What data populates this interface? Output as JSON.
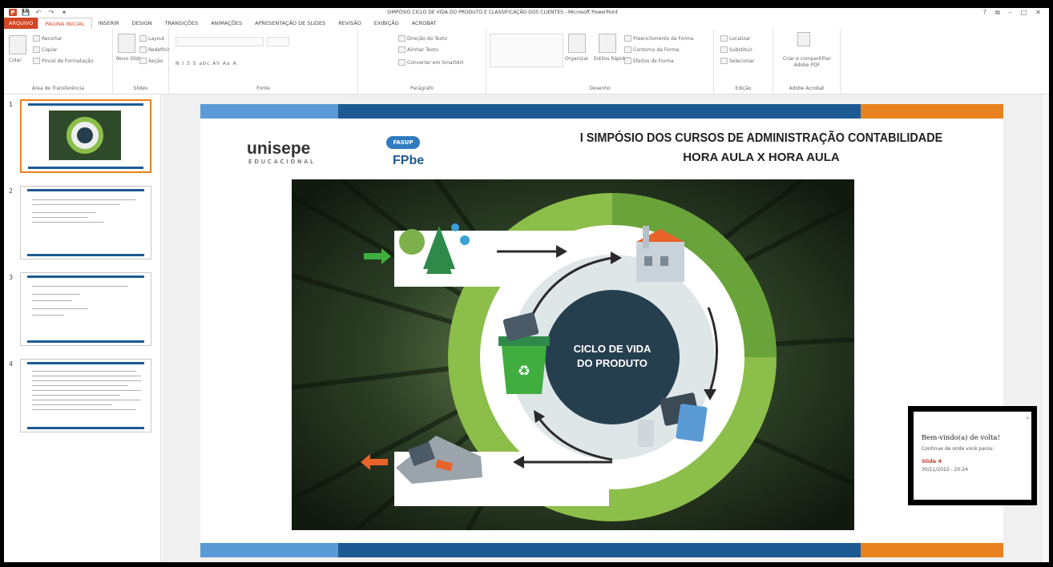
{
  "window": {
    "title": "SIMPÓSIO CICLO DE VIDA DO PRODUTO E CLASSIFICAÇÃO DOS CLIENTES - Microsoft PowerPoint",
    "controls": [
      "?",
      "⧉",
      "–",
      "□",
      "✕"
    ]
  },
  "quick_access": {
    "logo": "P",
    "save": "💾",
    "undo": "↶",
    "redo": "↷",
    "customize": "▾"
  },
  "tabs": [
    {
      "label": "ARQUIVO",
      "type": "file"
    },
    {
      "label": "PÁGINA INICIAL",
      "type": "active"
    },
    {
      "label": "INSERIR"
    },
    {
      "label": "DESIGN"
    },
    {
      "label": "TRANSIÇÕES"
    },
    {
      "label": "ANIMAÇÕES"
    },
    {
      "label": "APRESENTAÇÃO DE SLIDES"
    },
    {
      "label": "REVISÃO"
    },
    {
      "label": "EXIBIÇÃO"
    },
    {
      "label": "ACROBAT"
    }
  ],
  "ribbon": {
    "clipboard": {
      "name": "Área de Transferência",
      "paste": "Colar",
      "cut": "Recortar",
      "copy": "Copiar",
      "format_painter": "Pincel de Formatação"
    },
    "slides": {
      "name": "Slides",
      "new_slide": "Novo Slide",
      "layout": "Layout",
      "reset": "Redefinir",
      "section": "Seção"
    },
    "font": {
      "name": "Fonte",
      "controls": "N  I  S  S  abc  AV  Aa  A"
    },
    "paragraph": {
      "name": "Parágrafo",
      "text_direction": "Direção do Texto",
      "align_text": "Alinhar Texto",
      "smartart": "Converter em SmartArt"
    },
    "drawing": {
      "name": "Desenho",
      "arrange": "Organizar",
      "quick_styles": "Estilos Rápidos",
      "fill": "Preenchimento da Forma",
      "outline": "Contorno da Forma",
      "effects": "Efeitos de Forma"
    },
    "editing": {
      "name": "Edição",
      "find": "Localizar",
      "replace": "Substituir",
      "select": "Selecionar"
    },
    "acrobat": {
      "name": "Adobe Acrobat",
      "create": "Criar e compartilhar Adobe PDF"
    }
  },
  "thumbnails": [
    {
      "num": "1"
    },
    {
      "num": "2"
    },
    {
      "num": "3"
    },
    {
      "num": "4"
    }
  ],
  "slide": {
    "title_line1": "I SIMPÓSIO DOS CURSOS DE ADMINISTRAÇÃO CONTABILIDADE",
    "title_line2": "HORA AULA X HORA AULA",
    "logo_main": "unisepe",
    "logo_sub": "EDUCACIONAL",
    "logo_fasup": "FASUP",
    "logo_fpbe": "FPbe",
    "cycle_line1": "CICLO DE VIDA",
    "cycle_line2": "DO PRODUTO",
    "colors": {
      "blue": "#1d5a94",
      "light_blue": "#5b9bd5",
      "orange": "#e8821f",
      "green_dark": "#3d7a2a",
      "green": "#8cbe4a",
      "navy": "#263f4f"
    }
  },
  "popup": {
    "heading": "Bem-vindo(a) de volta!",
    "subtitle": "Continue de onde você parou:",
    "slide_label": "Slide 4",
    "date": "30/11/2022 - 20:24"
  }
}
